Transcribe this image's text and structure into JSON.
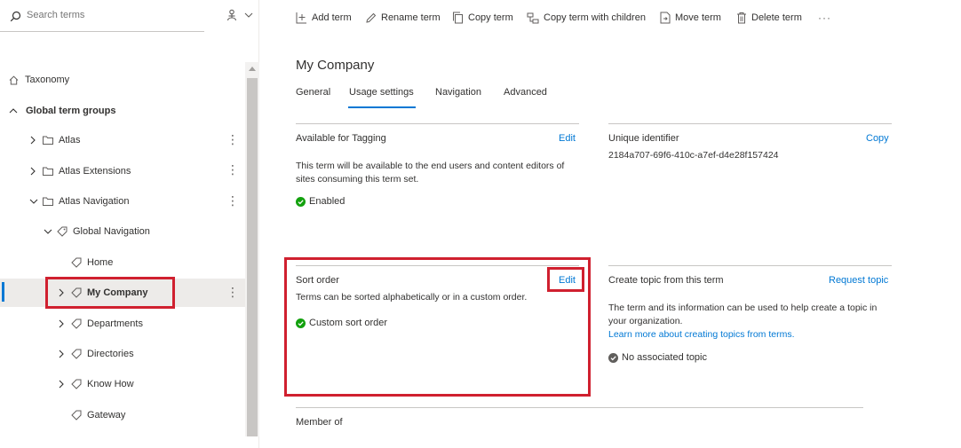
{
  "search": {
    "placeholder": "Search terms"
  },
  "tree": {
    "root": "Taxonomy",
    "group": "Global term groups",
    "items": [
      {
        "label": "Atlas"
      },
      {
        "label": "Atlas Extensions"
      },
      {
        "label": "Atlas Navigation"
      },
      {
        "label": "Global Navigation"
      },
      {
        "label": "Home"
      },
      {
        "label": "My Company"
      },
      {
        "label": "Departments"
      },
      {
        "label": "Directories"
      },
      {
        "label": "Know How"
      },
      {
        "label": "Gateway"
      }
    ]
  },
  "toolbar": {
    "add_term": "Add term",
    "rename_term": "Rename term",
    "copy_term": "Copy term",
    "copy_with_children": "Copy term with children",
    "move_term": "Move term",
    "delete_term": "Delete term",
    "more": "···"
  },
  "page": {
    "title": "My Company",
    "tabs": [
      "General",
      "Usage settings",
      "Navigation",
      "Advanced"
    ],
    "active_tab": "Usage settings"
  },
  "tagging": {
    "title": "Available for Tagging",
    "edit": "Edit",
    "description": "This term will be available to the end users and content editors of sites consuming this term set.",
    "status": "Enabled"
  },
  "identifier": {
    "title": "Unique identifier",
    "copy": "Copy",
    "value": "2184a707-69f6-410c-a7ef-d4e28f157424"
  },
  "sort_order": {
    "title": "Sort order",
    "edit": "Edit",
    "description": "Terms can be sorted alphabetically or in a custom order.",
    "status": "Custom sort order"
  },
  "topic": {
    "title": "Create topic from this term",
    "request": "Request topic",
    "description": "The term and its information can be used to help create a topic in your organization.",
    "learn_more": "Learn more about creating topics from terms.",
    "status": "No associated topic"
  },
  "member_of": {
    "title": "Member of"
  },
  "colors": {
    "accent": "#0078d4",
    "success": "#13a10e",
    "highlight": "#d0202f",
    "neutral": "#605e5c"
  }
}
